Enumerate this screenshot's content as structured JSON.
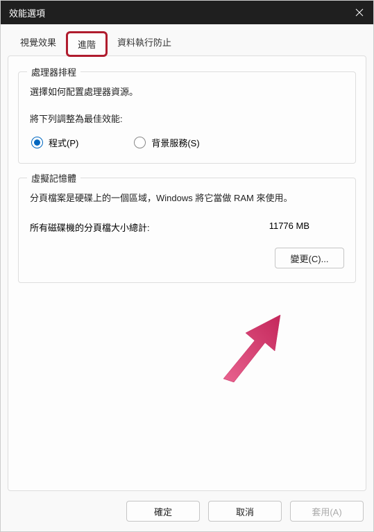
{
  "titlebar": {
    "title": "效能選項"
  },
  "tabs": {
    "visual": "視覺效果",
    "advanced": "進階",
    "dep": "資料執行防止"
  },
  "processor": {
    "legend": "處理器排程",
    "desc": "選擇如何配置處理器資源。",
    "adjust_label": "將下列調整為最佳效能:",
    "radio_programs": "程式(P)",
    "radio_background": "背景服務(S)"
  },
  "virtual_memory": {
    "legend": "虛擬記憶體",
    "desc": "分頁檔案是硬碟上的一個區域，Windows 將它當做 RAM 來使用。",
    "total_label": "所有磁碟機的分頁檔大小總計:",
    "total_value": "11776 MB",
    "change_button": "變更(C)..."
  },
  "footer": {
    "ok": "確定",
    "cancel": "取消",
    "apply": "套用(A)"
  }
}
